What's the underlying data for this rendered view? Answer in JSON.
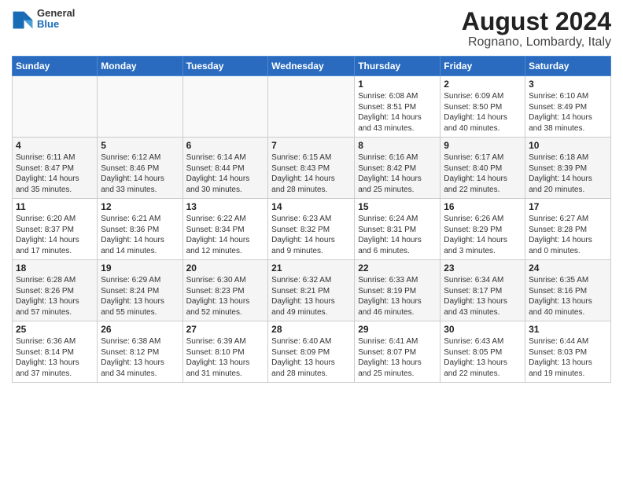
{
  "header": {
    "logo_general": "General",
    "logo_blue": "Blue",
    "title": "August 2024",
    "subtitle": "Rognano, Lombardy, Italy"
  },
  "weekdays": [
    "Sunday",
    "Monday",
    "Tuesday",
    "Wednesday",
    "Thursday",
    "Friday",
    "Saturday"
  ],
  "weeks": [
    [
      {
        "day": "",
        "info": ""
      },
      {
        "day": "",
        "info": ""
      },
      {
        "day": "",
        "info": ""
      },
      {
        "day": "",
        "info": ""
      },
      {
        "day": "1",
        "info": "Sunrise: 6:08 AM\nSunset: 8:51 PM\nDaylight: 14 hours\nand 43 minutes."
      },
      {
        "day": "2",
        "info": "Sunrise: 6:09 AM\nSunset: 8:50 PM\nDaylight: 14 hours\nand 40 minutes."
      },
      {
        "day": "3",
        "info": "Sunrise: 6:10 AM\nSunset: 8:49 PM\nDaylight: 14 hours\nand 38 minutes."
      }
    ],
    [
      {
        "day": "4",
        "info": "Sunrise: 6:11 AM\nSunset: 8:47 PM\nDaylight: 14 hours\nand 35 minutes."
      },
      {
        "day": "5",
        "info": "Sunrise: 6:12 AM\nSunset: 8:46 PM\nDaylight: 14 hours\nand 33 minutes."
      },
      {
        "day": "6",
        "info": "Sunrise: 6:14 AM\nSunset: 8:44 PM\nDaylight: 14 hours\nand 30 minutes."
      },
      {
        "day": "7",
        "info": "Sunrise: 6:15 AM\nSunset: 8:43 PM\nDaylight: 14 hours\nand 28 minutes."
      },
      {
        "day": "8",
        "info": "Sunrise: 6:16 AM\nSunset: 8:42 PM\nDaylight: 14 hours\nand 25 minutes."
      },
      {
        "day": "9",
        "info": "Sunrise: 6:17 AM\nSunset: 8:40 PM\nDaylight: 14 hours\nand 22 minutes."
      },
      {
        "day": "10",
        "info": "Sunrise: 6:18 AM\nSunset: 8:39 PM\nDaylight: 14 hours\nand 20 minutes."
      }
    ],
    [
      {
        "day": "11",
        "info": "Sunrise: 6:20 AM\nSunset: 8:37 PM\nDaylight: 14 hours\nand 17 minutes."
      },
      {
        "day": "12",
        "info": "Sunrise: 6:21 AM\nSunset: 8:36 PM\nDaylight: 14 hours\nand 14 minutes."
      },
      {
        "day": "13",
        "info": "Sunrise: 6:22 AM\nSunset: 8:34 PM\nDaylight: 14 hours\nand 12 minutes."
      },
      {
        "day": "14",
        "info": "Sunrise: 6:23 AM\nSunset: 8:32 PM\nDaylight: 14 hours\nand 9 minutes."
      },
      {
        "day": "15",
        "info": "Sunrise: 6:24 AM\nSunset: 8:31 PM\nDaylight: 14 hours\nand 6 minutes."
      },
      {
        "day": "16",
        "info": "Sunrise: 6:26 AM\nSunset: 8:29 PM\nDaylight: 14 hours\nand 3 minutes."
      },
      {
        "day": "17",
        "info": "Sunrise: 6:27 AM\nSunset: 8:28 PM\nDaylight: 14 hours\nand 0 minutes."
      }
    ],
    [
      {
        "day": "18",
        "info": "Sunrise: 6:28 AM\nSunset: 8:26 PM\nDaylight: 13 hours\nand 57 minutes."
      },
      {
        "day": "19",
        "info": "Sunrise: 6:29 AM\nSunset: 8:24 PM\nDaylight: 13 hours\nand 55 minutes."
      },
      {
        "day": "20",
        "info": "Sunrise: 6:30 AM\nSunset: 8:23 PM\nDaylight: 13 hours\nand 52 minutes."
      },
      {
        "day": "21",
        "info": "Sunrise: 6:32 AM\nSunset: 8:21 PM\nDaylight: 13 hours\nand 49 minutes."
      },
      {
        "day": "22",
        "info": "Sunrise: 6:33 AM\nSunset: 8:19 PM\nDaylight: 13 hours\nand 46 minutes."
      },
      {
        "day": "23",
        "info": "Sunrise: 6:34 AM\nSunset: 8:17 PM\nDaylight: 13 hours\nand 43 minutes."
      },
      {
        "day": "24",
        "info": "Sunrise: 6:35 AM\nSunset: 8:16 PM\nDaylight: 13 hours\nand 40 minutes."
      }
    ],
    [
      {
        "day": "25",
        "info": "Sunrise: 6:36 AM\nSunset: 8:14 PM\nDaylight: 13 hours\nand 37 minutes."
      },
      {
        "day": "26",
        "info": "Sunrise: 6:38 AM\nSunset: 8:12 PM\nDaylight: 13 hours\nand 34 minutes."
      },
      {
        "day": "27",
        "info": "Sunrise: 6:39 AM\nSunset: 8:10 PM\nDaylight: 13 hours\nand 31 minutes."
      },
      {
        "day": "28",
        "info": "Sunrise: 6:40 AM\nSunset: 8:09 PM\nDaylight: 13 hours\nand 28 minutes."
      },
      {
        "day": "29",
        "info": "Sunrise: 6:41 AM\nSunset: 8:07 PM\nDaylight: 13 hours\nand 25 minutes."
      },
      {
        "day": "30",
        "info": "Sunrise: 6:43 AM\nSunset: 8:05 PM\nDaylight: 13 hours\nand 22 minutes."
      },
      {
        "day": "31",
        "info": "Sunrise: 6:44 AM\nSunset: 8:03 PM\nDaylight: 13 hours\nand 19 minutes."
      }
    ]
  ]
}
